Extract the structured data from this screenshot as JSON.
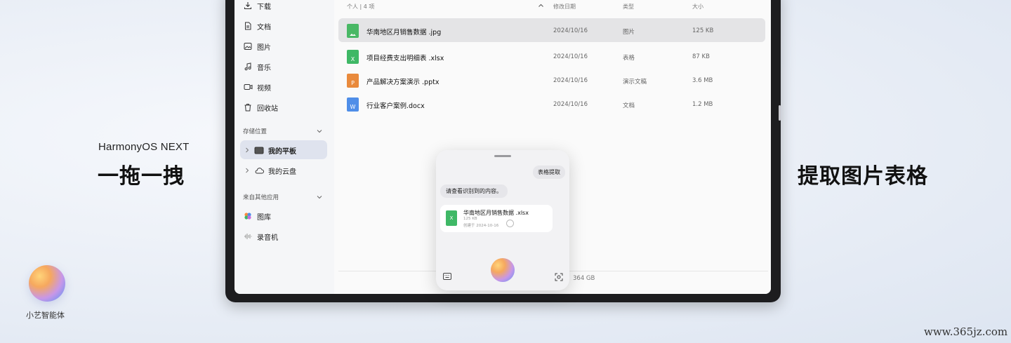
{
  "brand": "HarmonyOS NEXT",
  "slogan_left": "一拖一拽",
  "slogan_right": "提取图片表格",
  "assistant_label": "小艺智能体",
  "watermark": "www.365jz.com",
  "sidebar": {
    "items": [
      {
        "label": "下载",
        "icon": "download-icon"
      },
      {
        "label": "文档",
        "icon": "document-icon"
      },
      {
        "label": "图片",
        "icon": "image-icon"
      },
      {
        "label": "音乐",
        "icon": "music-icon"
      },
      {
        "label": "视频",
        "icon": "video-icon"
      },
      {
        "label": "回收站",
        "icon": "trash-icon"
      }
    ],
    "storage_header": "存储位置",
    "storage_items": [
      {
        "label": "我的平板",
        "icon": "tablet-icon"
      },
      {
        "label": "我的云盘",
        "icon": "cloud-icon"
      }
    ],
    "apps_header": "来自其他应用",
    "app_items": [
      {
        "label": "图库",
        "icon": "gallery-icon"
      },
      {
        "label": "录音机",
        "icon": "recorder-icon"
      }
    ]
  },
  "file_list": {
    "count_label": "个人 | 4 项",
    "columns": {
      "date": "修改日期",
      "type": "类型",
      "size": "大小"
    },
    "files": [
      {
        "name": "华南地区月销售数据 .jpg",
        "date": "2024/10/16",
        "type": "图片",
        "size": "125 KB",
        "icon_letter": "",
        "color": "#49b865"
      },
      {
        "name": "项目经费支出明细表 .xlsx",
        "date": "2024/10/16",
        "type": "表格",
        "size": "87 KB",
        "icon_letter": "X",
        "color": "#3fb866"
      },
      {
        "name": "产品解决方案演示 .pptx",
        "date": "2024/10/16",
        "type": "演示文稿",
        "size": "3.6 MB",
        "icon_letter": "P",
        "color": "#e98a3c"
      },
      {
        "name": "行业客户案例.docx",
        "date": "2024/10/16",
        "type": "文档",
        "size": "1.2 MB",
        "icon_letter": "W",
        "color": "#4f8ee8"
      }
    ],
    "storage_text": "364 GB"
  },
  "assistant_panel": {
    "user_bubble": "表格提取",
    "reply_bubble": "请查看识别到的内容。",
    "card": {
      "name": "华南地区月销售数据 .xlsx",
      "size": "125 KB",
      "date": "创建于 2024-10-16",
      "icon_letter": "X"
    }
  }
}
